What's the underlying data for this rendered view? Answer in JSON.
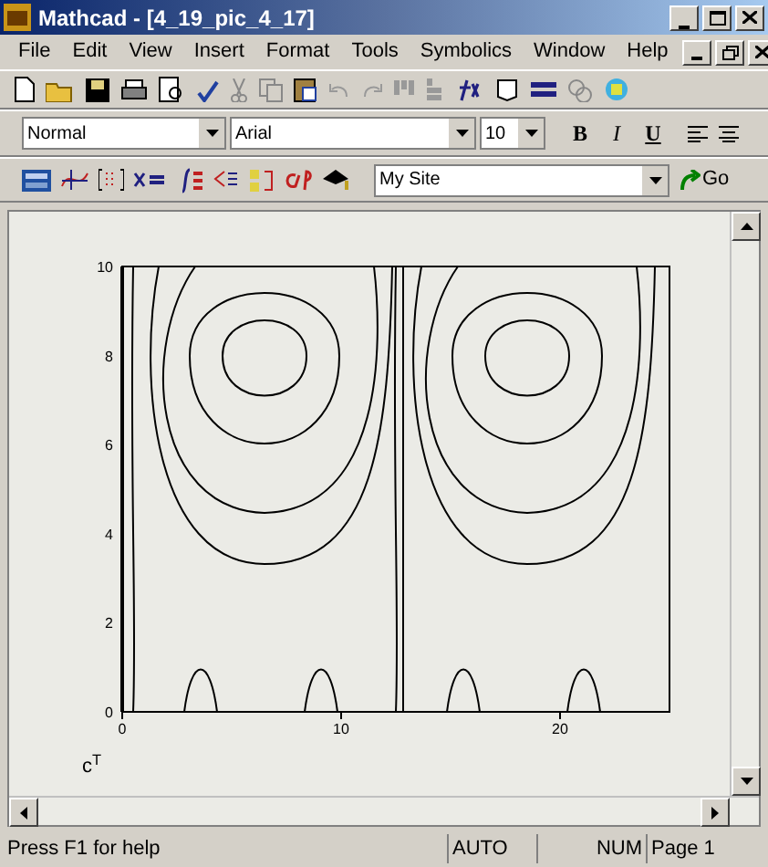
{
  "window": {
    "title": "Mathcad - [4_19_pic_4_17]"
  },
  "menu": [
    "File",
    "Edit",
    "View",
    "Insert",
    "Format",
    "Tools",
    "Symbolics",
    "Window",
    "Help"
  ],
  "format_bar": {
    "style": "Normal",
    "font": "Arial",
    "size": "10",
    "bold": "B",
    "italic": "I",
    "underline": "U"
  },
  "math_bar": {
    "site": "My Site",
    "go": "Go"
  },
  "plot": {
    "x_ticks": [
      "0",
      "10",
      "20"
    ],
    "y_ticks": [
      "10",
      "8",
      "6",
      "4",
      "2",
      "0"
    ],
    "label": "c$^{T}$"
  },
  "status_bar": {
    "hint": "Press F1 for help",
    "mode": "AUTO",
    "num": "NUM",
    "page": "Page 1"
  }
}
